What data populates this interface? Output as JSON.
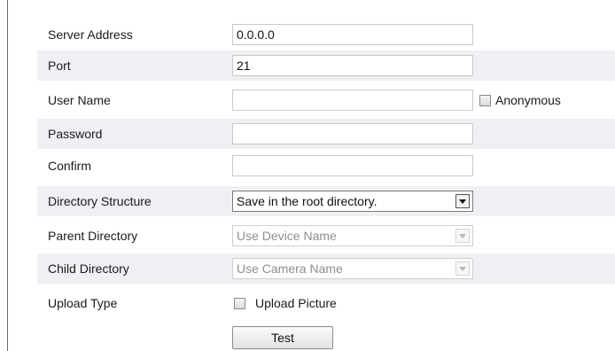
{
  "form": {
    "server_address": {
      "label": "Server Address",
      "value": "0.0.0.0"
    },
    "port": {
      "label": "Port",
      "value": "21"
    },
    "user_name": {
      "label": "User Name",
      "value": "",
      "anonymous_label": "Anonymous",
      "anonymous_checked": false
    },
    "password": {
      "label": "Password",
      "value": ""
    },
    "confirm": {
      "label": "Confirm",
      "value": ""
    },
    "directory_structure": {
      "label": "Directory Structure",
      "selected": "Save in the root directory."
    },
    "parent_directory": {
      "label": "Parent Directory",
      "selected": "Use Device Name",
      "disabled": true
    },
    "child_directory": {
      "label": "Child Directory",
      "selected": "Use Camera Name",
      "disabled": true
    },
    "upload_type": {
      "label": "Upload Type",
      "option_label": "Upload Picture",
      "checked": false
    },
    "test_button": "Test"
  }
}
